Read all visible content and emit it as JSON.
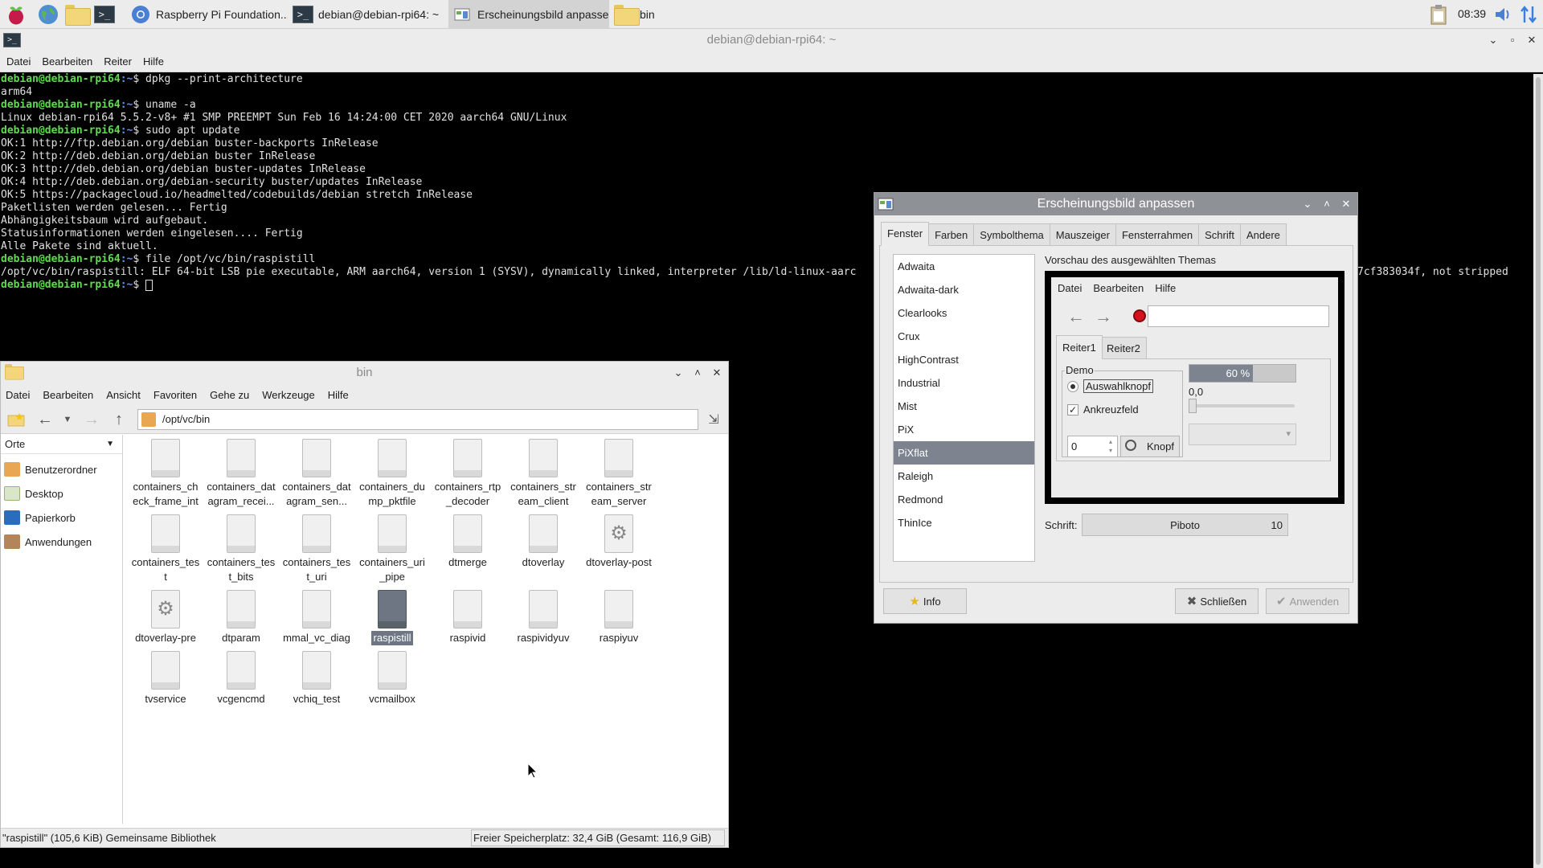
{
  "taskbar": {
    "tasks": [
      {
        "label": "Raspberry Pi Foundation..."
      },
      {
        "label": "debian@debian-rpi64: ~"
      },
      {
        "label": "Erscheinungsbild anpassen"
      },
      {
        "label": "bin"
      }
    ],
    "clock": "08:39"
  },
  "terminal": {
    "title": "debian@debian-rpi64: ~",
    "menu": [
      "Datei",
      "Bearbeiten",
      "Reiter",
      "Hilfe"
    ],
    "prompt_user": "debian@debian-rpi64",
    "prompt_path": ":~",
    "prompt_sym": "$ ",
    "cmd1": "dpkg --print-architecture",
    "out1": "arm64",
    "cmd2": "uname -a",
    "out2": "Linux debian-rpi64 5.5.2-v8+ #1 SMP PREEMPT Sun Feb 16 14:24:00 CET 2020 aarch64 GNU/Linux",
    "cmd3": "sudo apt update",
    "out3": [
      "OK:1 http://ftp.debian.org/debian buster-backports InRelease",
      "OK:2 http://deb.debian.org/debian buster InRelease",
      "OK:3 http://deb.debian.org/debian buster-updates InRelease",
      "OK:4 http://deb.debian.org/debian-security buster/updates InRelease",
      "OK:5 https://packagecloud.io/headmelted/codebuilds/debian stretch InRelease",
      "Paketlisten werden gelesen... Fertig",
      "Abhängigkeitsbaum wird aufgebaut.",
      "Statusinformationen werden eingelesen.... Fertig",
      "Alle Pakete sind aktuell."
    ],
    "cmd4": "file /opt/vc/bin/raspistill",
    "out4": "/opt/vc/bin/raspistill: ELF 64-bit LSB pie executable, ARM aarch64, version 1 (SYSV), dynamically linked, interpreter /lib/ld-linux-aarc",
    "out4_tail": "7cf383034f, not stripped"
  },
  "filemanager": {
    "title": "bin",
    "menu": [
      "Datei",
      "Bearbeiten",
      "Ansicht",
      "Favoriten",
      "Gehe zu",
      "Werkzeuge",
      "Hilfe"
    ],
    "path": "/opt/vc/bin",
    "places_header": "Orte",
    "places": [
      "Benutzerordner",
      "Desktop",
      "Papierkorb",
      "Anwendungen"
    ],
    "files": [
      "containers_check_frame_int",
      "containers_datagram_recei...",
      "containers_datagram_sen...",
      "containers_dump_pktfile",
      "containers_rtp_decoder",
      "containers_stream_client",
      "containers_stream_server",
      "containers_test",
      "containers_test_bits",
      "containers_test_uri",
      "containers_uri_pipe",
      "dtmerge",
      "dtoverlay",
      "dtoverlay-post",
      "dtoverlay-pre",
      "dtparam",
      "mmal_vc_diag",
      "raspistill",
      "raspivid",
      "raspividyuv",
      "raspiyuv",
      "tvservice",
      "vcgencmd",
      "vchiq_test",
      "vcmailbox"
    ],
    "status_left": "\"raspistill\" (105,6 KiB) Gemeinsame Bibliothek",
    "status_right": "Freier Speicherplatz: 32,4 GiB (Gesamt: 116,9 GiB)"
  },
  "dialog": {
    "title": "Erscheinungsbild anpassen",
    "tabs": [
      "Fenster",
      "Farben",
      "Symbolthema",
      "Mauszeiger",
      "Fensterrahmen",
      "Schrift",
      "Andere"
    ],
    "themes": [
      "Adwaita",
      "Adwaita-dark",
      "Clearlooks",
      "Crux",
      "HighContrast",
      "Industrial",
      "Mist",
      "PiX",
      "PiXflat",
      "Raleigh",
      "Redmond",
      "ThinIce"
    ],
    "selected_theme": "PiXflat",
    "preview_label": "Vorschau des ausgewählten Themas",
    "preview": {
      "menu": [
        "Datei",
        "Bearbeiten",
        "Hilfe"
      ],
      "tab1": "Reiter1",
      "tab2": "Reiter2",
      "frame_label": "Demo",
      "radio_label": "Auswahlknopf",
      "check_label": "Ankreuzfeld",
      "spin_value": "0",
      "button_label": "Knopf",
      "progress_text": "60 %",
      "progress_value": 0.6,
      "scale_value": "0,0"
    },
    "font_label": "Schrift:",
    "font_name": "Piboto",
    "font_size": "10",
    "btn_info": "Info",
    "btn_close": "Schließen",
    "btn_apply": "Anwenden"
  }
}
